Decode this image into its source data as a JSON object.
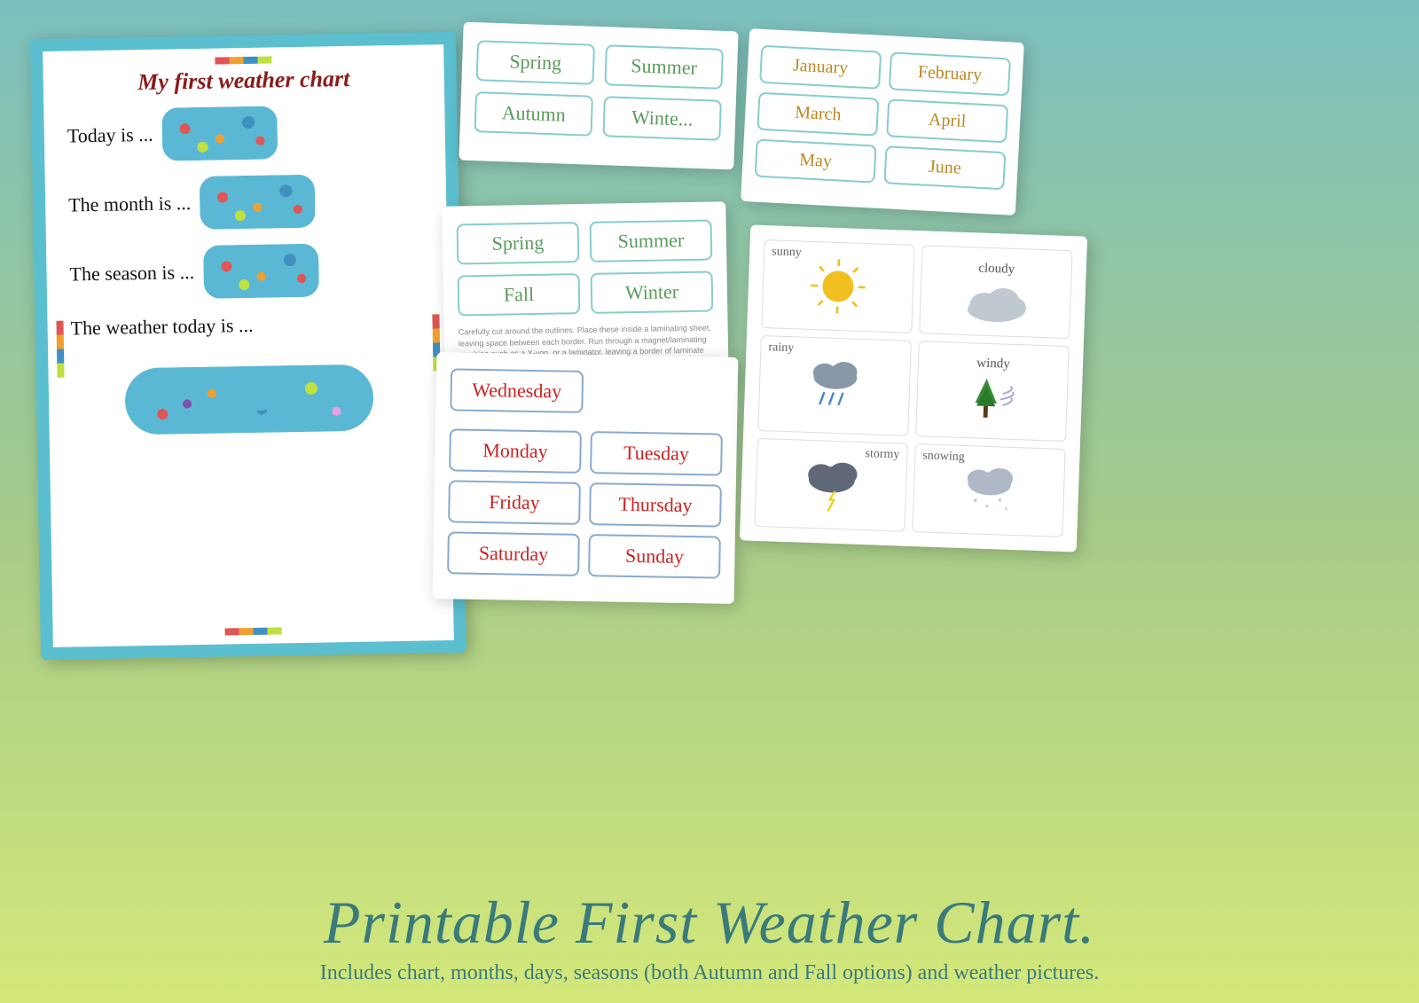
{
  "mainChart": {
    "title": "My first weather chart",
    "rows": [
      {
        "label": "Today is ..."
      },
      {
        "label": "The month is ..."
      },
      {
        "label": "The season is ..."
      },
      {
        "label": "The weather today is ..."
      }
    ]
  },
  "seasonsTop": {
    "rows": [
      [
        "Spring",
        "Summer"
      ],
      [
        "Autumn",
        "Winte..."
      ]
    ]
  },
  "seasonsMid": {
    "rows": [
      [
        "Spring",
        "Summer"
      ],
      [
        "Fall",
        "Winter"
      ]
    ],
    "instruction": "Carefully cut around the outlines. Place these inside a laminating sheet, leaving space between each border. Run through a magnet/laminating machine such as a X-yon, or a laminator. leaving a border of laminate around each. Attach magnetic tape to the backs if needed, or strips"
  },
  "days": {
    "wednesday": "Wednesday",
    "rows": [
      [
        "Monday",
        "Tuesday"
      ],
      [
        "Friday",
        "Thursday"
      ],
      [
        "Saturday",
        "Sunday"
      ]
    ]
  },
  "months": {
    "rows": [
      [
        "January",
        "February"
      ],
      [
        "March",
        "April"
      ],
      [
        "May",
        "June"
      ]
    ]
  },
  "weather": {
    "items": [
      {
        "label": "sunny",
        "type": "sun"
      },
      {
        "label": "cloudy",
        "type": "cloud"
      },
      {
        "label": "rainy",
        "type": "rain"
      },
      {
        "label": "windy",
        "type": "wind"
      },
      {
        "label": "stormy",
        "type": "storm"
      },
      {
        "label": "snowing",
        "type": "snow"
      }
    ]
  },
  "footer": {
    "title": "Printable First Weather Chart.",
    "subtitle": "Includes chart, months, days, seasons (both Autumn and Fall options) and weather pictures."
  },
  "colors": {
    "teal": "#3a7a7a",
    "chartBorder": "#5bbfcf",
    "seasonGreen": "#5a9a5a",
    "monthGold": "#bb8822",
    "dayRed": "#cc2222",
    "titleRed": "#8b1a1a"
  }
}
